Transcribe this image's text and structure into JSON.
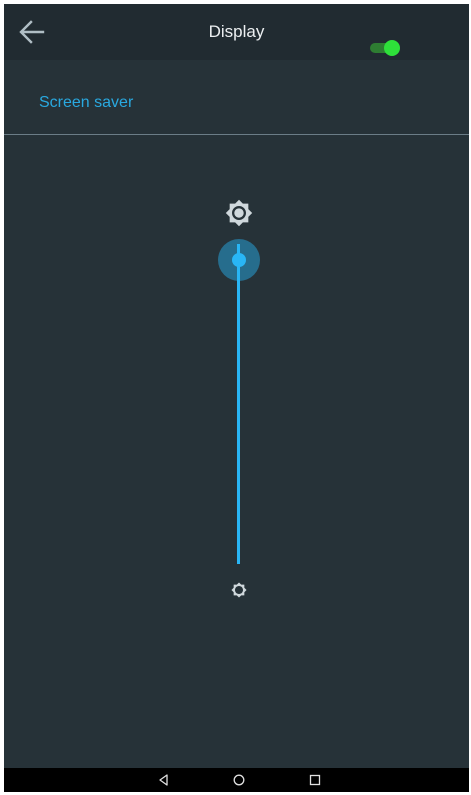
{
  "toolbar": {
    "title": "Display",
    "back_icon": "arrow-back-icon"
  },
  "settings": {
    "screen_saver": {
      "label": "Screen saver",
      "enabled": true
    }
  },
  "brightness": {
    "level": 0.95,
    "max_icon": "brightness-high-icon",
    "min_icon": "brightness-low-icon"
  },
  "navigation_bar": {
    "buttons": [
      "nav-back-icon",
      "nav-home-icon",
      "nav-recents-icon"
    ]
  },
  "colors": {
    "accent": "#29b6f6",
    "label": "#29a9e0",
    "toggle_on": "#2ee03a",
    "background": "#263238",
    "toolbar": "#212b31"
  }
}
